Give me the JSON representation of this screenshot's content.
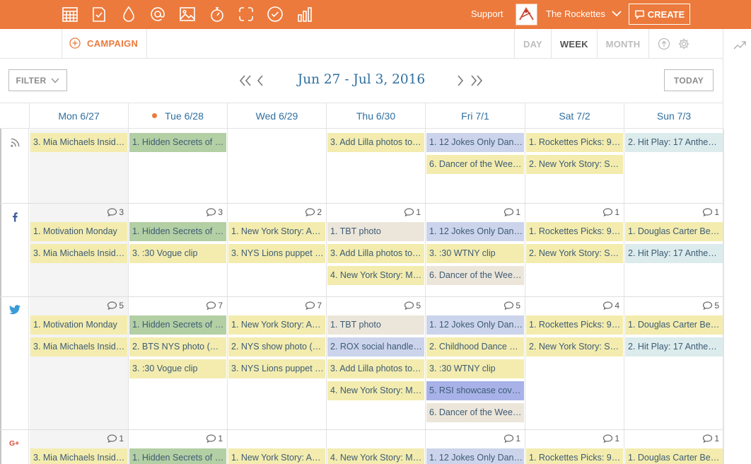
{
  "topbar": {
    "icons": [
      "calendar-grid-icon",
      "checklist-icon",
      "drop-icon",
      "at-icon",
      "image-icon",
      "stopwatch-icon",
      "dashed-square-icon",
      "check-circle-icon",
      "bar-chart-icon"
    ],
    "support_label": "Support",
    "org_name": "The Rockettes",
    "create_label": "CREATE"
  },
  "subbar": {
    "campaign_label": "CAMPAIGN",
    "tabs": [
      {
        "label": "DAY",
        "active": false
      },
      {
        "label": "WEEK",
        "active": true
      },
      {
        "label": "MONTH",
        "active": false
      }
    ]
  },
  "nav": {
    "filter_label": "FILTER",
    "range": "Jun 27 - Jul 3, 2016",
    "today_label": "TODAY"
  },
  "days": [
    {
      "label": "Mon 6/27",
      "today": false
    },
    {
      "label": "Tue 6/28",
      "today": true
    },
    {
      "label": "Wed 6/29",
      "today": false
    },
    {
      "label": "Thu 6/30",
      "today": false
    },
    {
      "label": "Fri 7/1",
      "today": false
    },
    {
      "label": "Sat 7/2",
      "today": false
    },
    {
      "label": "Sun 7/3",
      "today": false
    }
  ],
  "colors": {
    "brand": "#ec7a3c",
    "link": "#2f6f9f",
    "yellow": "#f3ecae",
    "green": "#b3cfa4",
    "blue": "#ccd4ec",
    "teal": "#dcebec",
    "beige": "#ece6da",
    "purple": "#a8b2e8"
  },
  "rows": [
    {
      "network": "rss",
      "icon": "rss-icon",
      "cells": [
        {
          "count": null,
          "posts": [
            {
              "text": "3. Mia Michaels Insid…",
              "color": "yellow"
            }
          ]
        },
        {
          "count": null,
          "posts": [
            {
              "text": "1. Hidden Secrets of …",
              "color": "green"
            }
          ]
        },
        {
          "count": null,
          "posts": []
        },
        {
          "count": null,
          "posts": [
            {
              "text": "3. Add Lilla photos to…",
              "color": "yellow"
            }
          ]
        },
        {
          "count": null,
          "posts": [
            {
              "text": "1. 12 Jokes Only Dan…",
              "color": "blue"
            },
            {
              "text": "6. Dancer of the Wee…",
              "color": "yellow"
            }
          ]
        },
        {
          "count": null,
          "posts": [
            {
              "text": "1. Rockettes Picks: 9 …",
              "color": "yellow"
            },
            {
              "text": "2. New York Story: Se…",
              "color": "yellow"
            }
          ]
        },
        {
          "count": null,
          "posts": [
            {
              "text": "2. Hit Play: 17 Anthem…",
              "color": "teal"
            }
          ]
        }
      ]
    },
    {
      "network": "facebook",
      "icon": "facebook-icon",
      "cells": [
        {
          "count": "3",
          "posts": [
            {
              "text": "1. Motivation Monday",
              "color": "yellow"
            },
            {
              "text": "3. Mia Michaels Insid…",
              "color": "yellow"
            }
          ]
        },
        {
          "count": "3",
          "posts": [
            {
              "text": "1. Hidden Secrets of …",
              "color": "green"
            },
            {
              "text": "3. :30 Vogue clip",
              "color": "yellow"
            }
          ]
        },
        {
          "count": "2",
          "posts": [
            {
              "text": "1. New York Story: An…",
              "color": "yellow"
            },
            {
              "text": "3. NYS Lions puppet …",
              "color": "yellow"
            }
          ]
        },
        {
          "count": "1",
          "posts": [
            {
              "text": "1. TBT photo",
              "color": "beige"
            },
            {
              "text": "3. Add Lilla photos to…",
              "color": "yellow"
            },
            {
              "text": "4. New York Story: Mi…",
              "color": "yellow"
            }
          ]
        },
        {
          "count": "1",
          "posts": [
            {
              "text": "1. 12 Jokes Only Dan…",
              "color": "blue"
            },
            {
              "text": "3. :30 WTNY clip",
              "color": "yellow"
            },
            {
              "text": "6. Dancer of the Wee…",
              "color": "beige"
            }
          ]
        },
        {
          "count": "1",
          "posts": [
            {
              "text": "1. Rockettes Picks: 9 …",
              "color": "yellow"
            },
            {
              "text": "2. New York Story: Se…",
              "color": "yellow"
            }
          ]
        },
        {
          "count": "1",
          "posts": [
            {
              "text": "1. Douglas Carter Bea…",
              "color": "yellow"
            },
            {
              "text": "2. Hit Play: 17 Anthem…",
              "color": "teal"
            }
          ]
        }
      ]
    },
    {
      "network": "twitter",
      "icon": "twitter-icon",
      "cells": [
        {
          "count": "5",
          "posts": [
            {
              "text": "1. Motivation Monday",
              "color": "yellow"
            },
            {
              "text": "3. Mia Michaels Insid…",
              "color": "yellow"
            }
          ]
        },
        {
          "count": "7",
          "posts": [
            {
              "text": "1. Hidden Secrets of …",
              "color": "green"
            },
            {
              "text": "2. BTS NYS photo (R…",
              "color": "yellow"
            },
            {
              "text": "3. :30 Vogue clip",
              "color": "yellow"
            }
          ]
        },
        {
          "count": "7",
          "posts": [
            {
              "text": "1. New York Story: An…",
              "color": "yellow"
            },
            {
              "text": "2. NYS show photo (…",
              "color": "yellow"
            },
            {
              "text": "3. NYS Lions puppet …",
              "color": "yellow"
            }
          ]
        },
        {
          "count": "5",
          "posts": [
            {
              "text": "1. TBT photo",
              "color": "beige"
            },
            {
              "text": "2. ROX social handles…",
              "color": "blue"
            },
            {
              "text": "3. Add Lilla photos to…",
              "color": "yellow"
            },
            {
              "text": "4. New York Story: Mi…",
              "color": "yellow"
            }
          ]
        },
        {
          "count": "5",
          "posts": [
            {
              "text": "1. 12 Jokes Only Dan…",
              "color": "blue"
            },
            {
              "text": "2. Childhood Dance P…",
              "color": "yellow"
            },
            {
              "text": "3. :30 WTNY clip",
              "color": "yellow"
            },
            {
              "text": "5. RSI showcase cov…",
              "color": "purple"
            },
            {
              "text": "6. Dancer of the Wee…",
              "color": "beige"
            }
          ]
        },
        {
          "count": "4",
          "posts": [
            {
              "text": "1. Rockettes Picks: 9 …",
              "color": "yellow"
            },
            {
              "text": "2. New York Story: Se…",
              "color": "yellow"
            }
          ]
        },
        {
          "count": "5",
          "posts": [
            {
              "text": "1. Douglas Carter Bea…",
              "color": "yellow"
            },
            {
              "text": "2. Hit Play: 17 Anthem…",
              "color": "teal"
            }
          ]
        }
      ]
    },
    {
      "network": "google-plus",
      "icon": "google-plus-icon",
      "cells": [
        {
          "count": "1",
          "posts": [
            {
              "text": "3. Mia Michaels Insid…",
              "color": "yellow"
            }
          ]
        },
        {
          "count": "1",
          "posts": [
            {
              "text": "1. Hidden Secrets of …",
              "color": "green"
            }
          ]
        },
        {
          "count": null,
          "posts": [
            {
              "text": "1. New York Story: An…",
              "color": "yellow"
            }
          ]
        },
        {
          "count": null,
          "posts": [
            {
              "text": "4. New York Story: Mi…",
              "color": "yellow"
            }
          ]
        },
        {
          "count": "1",
          "posts": [
            {
              "text": "1. 12 Jokes Only Dan…",
              "color": "blue"
            }
          ]
        },
        {
          "count": "1",
          "posts": [
            {
              "text": "1. Rockettes Picks: 9 …",
              "color": "yellow"
            }
          ]
        },
        {
          "count": "1",
          "posts": [
            {
              "text": "1. Douglas Carter Bea…",
              "color": "yellow"
            }
          ]
        }
      ]
    }
  ]
}
